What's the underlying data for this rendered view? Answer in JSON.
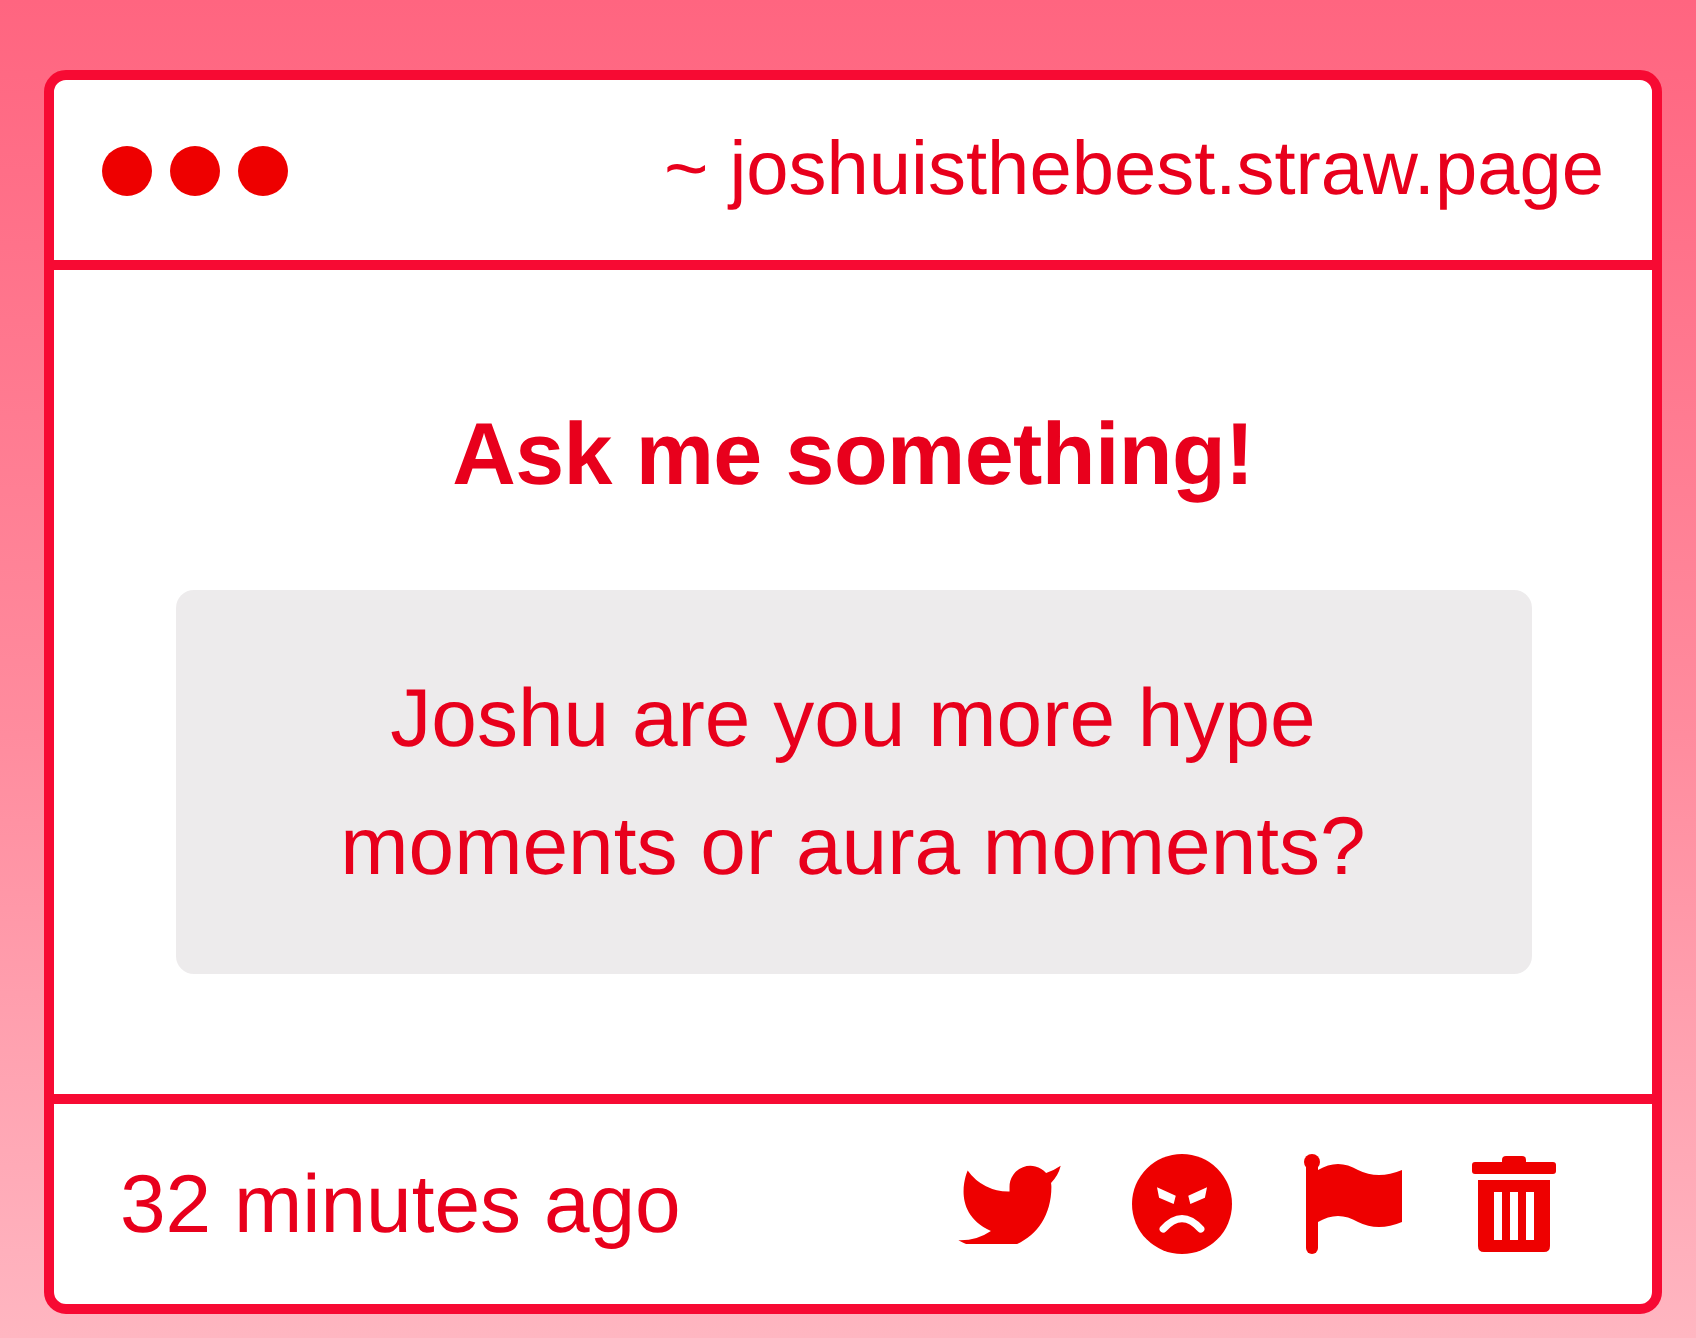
{
  "window": {
    "address": "~ joshuisthebest.straw.page"
  },
  "prompt": {
    "title": "Ask me something!"
  },
  "question": {
    "text": "Joshu are you more hype moments or aura moments?"
  },
  "footer": {
    "time": "32 minutes ago"
  }
}
